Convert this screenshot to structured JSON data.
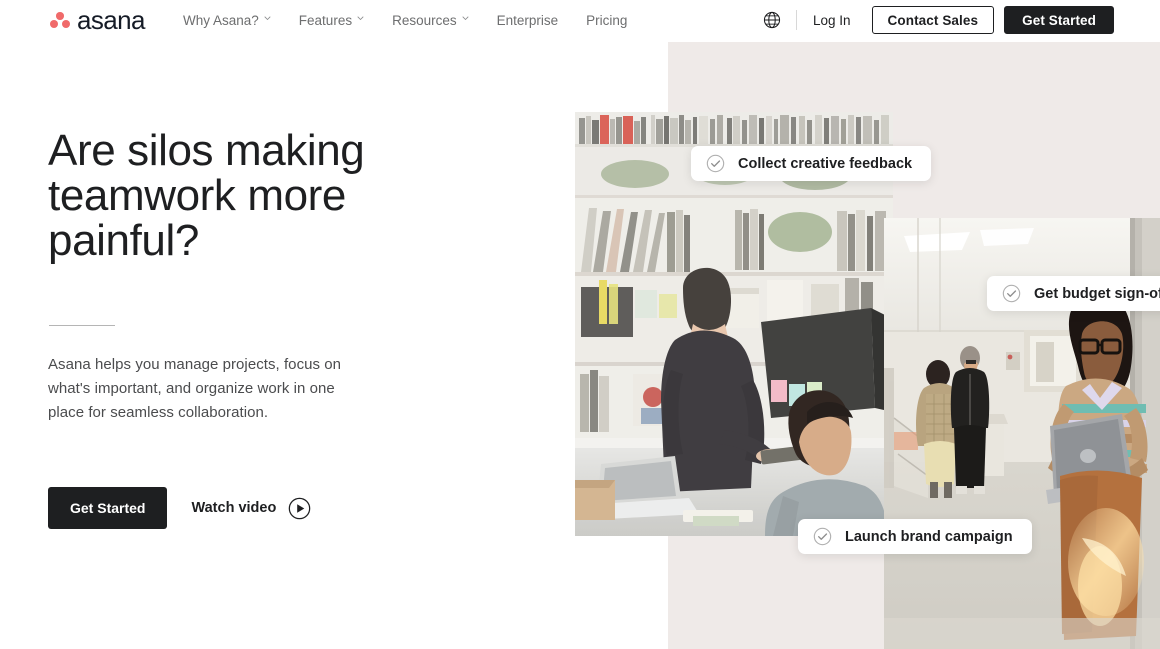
{
  "header": {
    "logo": {
      "text": "asana",
      "icon": "asana-dots-logo",
      "color": "#f06a6a"
    },
    "nav": [
      {
        "label": "Why Asana?",
        "has_caret": true
      },
      {
        "label": "Features",
        "has_caret": true
      },
      {
        "label": "Resources",
        "has_caret": true
      },
      {
        "label": "Enterprise",
        "has_caret": false
      },
      {
        "label": "Pricing",
        "has_caret": false
      }
    ],
    "language_icon": "globe-icon",
    "login_label": "Log In",
    "contact_sales_label": "Contact Sales",
    "get_started_label": "Get Started"
  },
  "hero": {
    "title": "Are silos making teamwork more painful?",
    "body": "Asana helps you manage projects, focus on what's important, and organize work in one place for seamless collaboration.",
    "primary_cta": "Get Started",
    "secondary_cta": "Watch video",
    "secondary_cta_icon": "play-circle-icon"
  },
  "task_cards": [
    {
      "label": "Collect creative feedback",
      "icon": "check-circle-icon"
    },
    {
      "label": "Get budget sign-off",
      "icon": "check-circle-icon"
    },
    {
      "label": "Launch brand campaign",
      "icon": "check-circle-icon"
    }
  ],
  "media": {
    "panel_color": "#efeae8",
    "photo_1_alt": "Two coworkers in a bright office with bookshelves, one standing with a tablet and one seated at a laptop",
    "photo_2_alt": "Woman with glasses holding a laptop in a sunlit office corridor with colleagues in the background"
  },
  "colors": {
    "brand": "#f06a6a",
    "ink": "#1e1f21",
    "muted": "#6d6e6f",
    "panel": "#efeae8"
  }
}
